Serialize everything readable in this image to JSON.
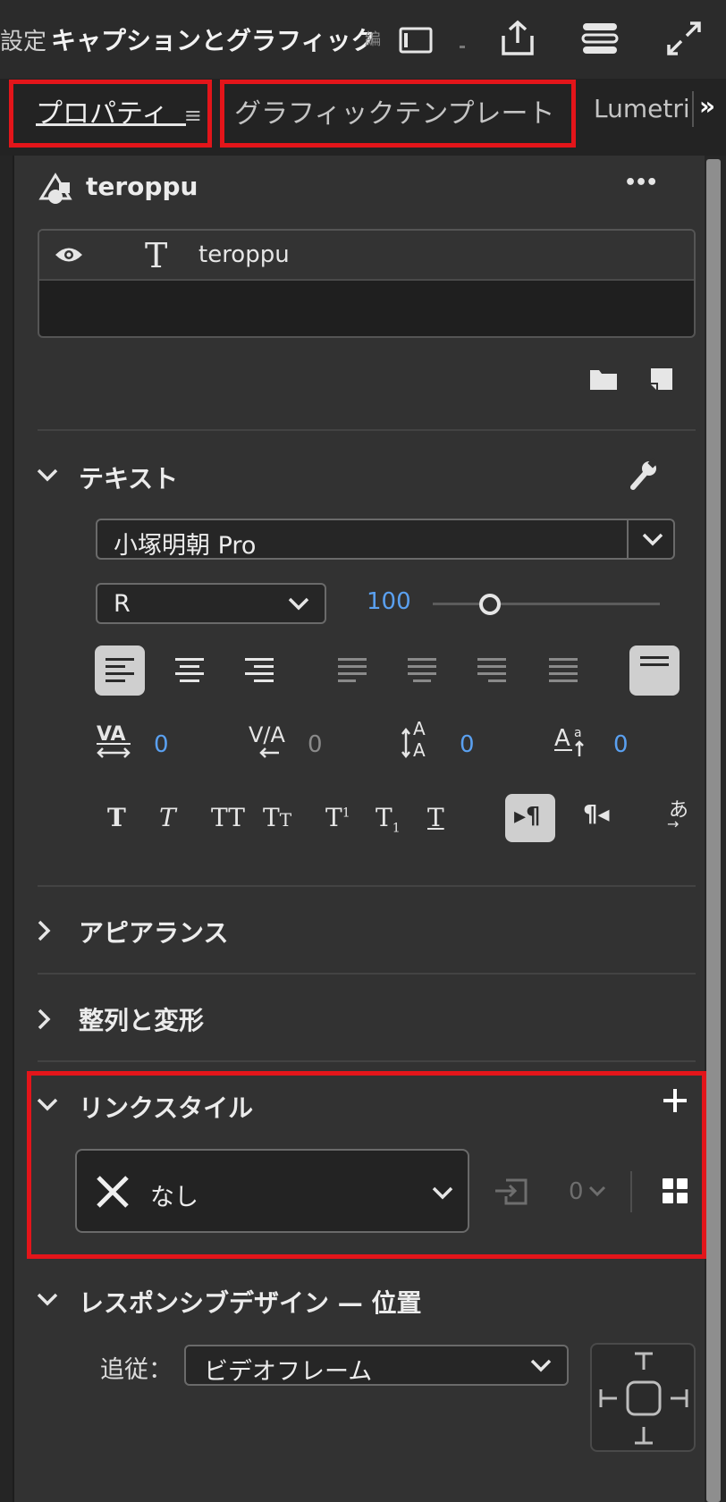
{
  "header": {
    "setting_label": "設定",
    "panel_title": "キャプションとグラフィック",
    "title_overflow": "編"
  },
  "tabs": {
    "properties": "プロパティ",
    "graphic_templates": "グラフィックテンプレート",
    "lumetri": "Lumetri",
    "more": "»"
  },
  "graphic": {
    "name": "teroppu",
    "more": "•••",
    "layers": [
      {
        "name": "teroppu",
        "visible": true,
        "kind": "text"
      }
    ]
  },
  "text_section": {
    "title": "テキスト",
    "font_family": "小塚明朝 Pro",
    "font_style": "R",
    "font_size": "100",
    "font_size_slider_fraction": 0.25,
    "kerning": "0",
    "tracking": "0",
    "leading": "0",
    "baseline_shift": "0",
    "vertical_text_label": "あ"
  },
  "sections": {
    "appearance": "アピアランス",
    "align_transform": "整列と変形",
    "linked_styles": "リンクスタイル",
    "responsive": "レスポンシブデザイン — 位置"
  },
  "linked_style": {
    "value": "なし",
    "count": "0"
  },
  "responsive": {
    "pin_label": "追従：",
    "pin_value": "ビデオフレーム"
  },
  "colors": {
    "highlight_red": "#e3151a",
    "value_blue": "#5aa0f0"
  }
}
